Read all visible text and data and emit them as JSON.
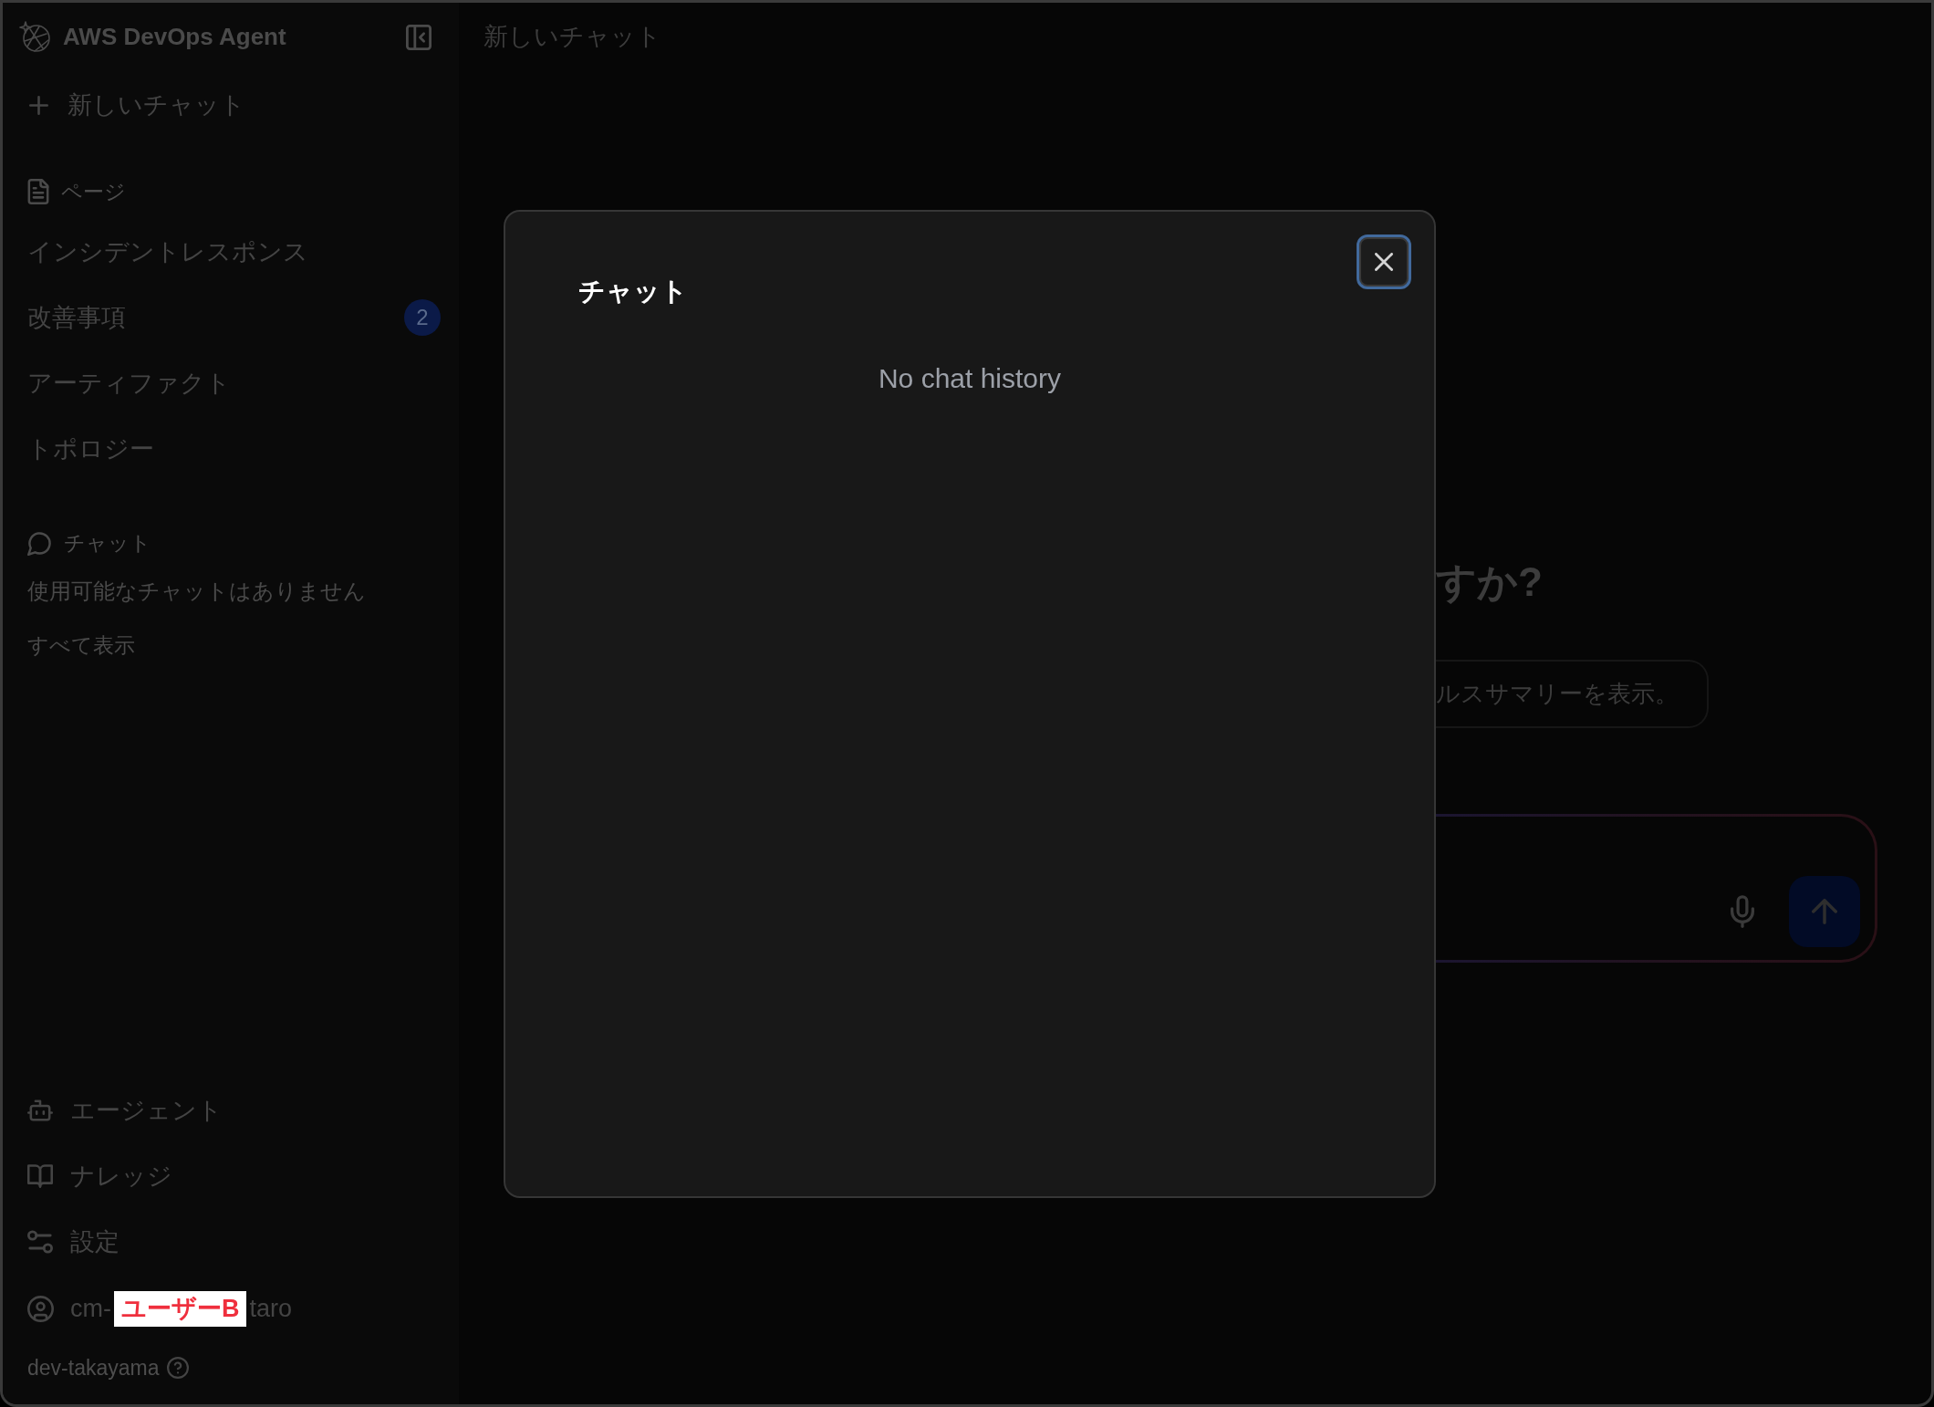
{
  "app": {
    "title": "AWS DevOps Agent"
  },
  "sidebar": {
    "new_chat": {
      "label": "新しいチャット"
    },
    "pages": {
      "heading": "ページ",
      "items": [
        {
          "label": "インシデントレスポンス"
        },
        {
          "label": "改善事項",
          "badge": "2"
        },
        {
          "label": "アーティファクト"
        },
        {
          "label": "トポロジー"
        }
      ]
    },
    "chats": {
      "heading": "チャット",
      "empty_message": "使用可能なチャットはありません",
      "show_all": "すべて表示"
    },
    "footer_items": [
      {
        "label": "エージェント"
      },
      {
        "label": "ナレッジ"
      },
      {
        "label": "設定"
      }
    ],
    "user": {
      "name_start": "cm-",
      "redaction": "ユーザーB",
      "name_end": "taro"
    },
    "account": {
      "label": "dev-takayama"
    }
  },
  "header": {
    "title": "新しいチャット"
  },
  "main": {
    "heading_fragment": "すか?",
    "suggestion_fragment": "ルスサマリーを表示。"
  },
  "dialog": {
    "title": "チャット",
    "empty_message": "No chat history"
  }
}
